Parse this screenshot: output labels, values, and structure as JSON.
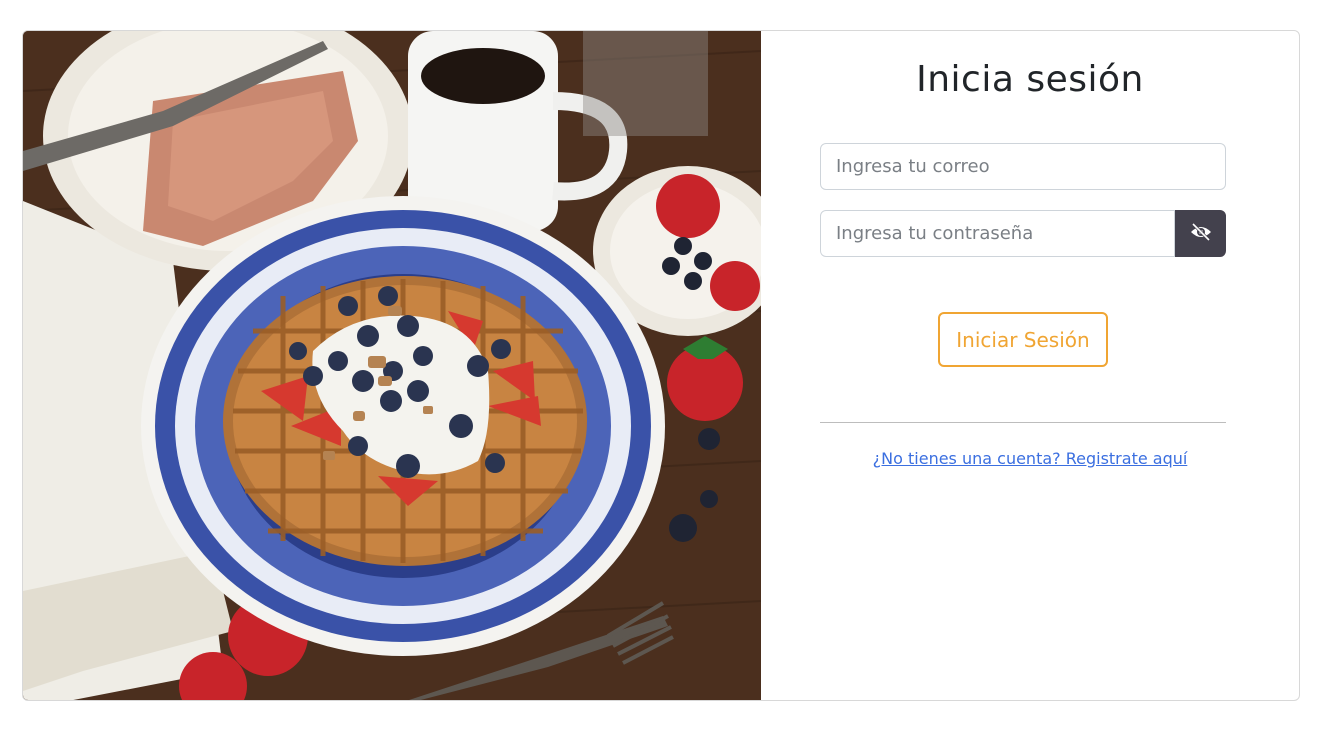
{
  "login": {
    "title": "Inicia sesión",
    "email_placeholder": "Ingresa tu correo",
    "password_placeholder": "Ingresa tu contraseña",
    "toggle_icon": "eye-slash-icon",
    "submit_label": "Iniciar Sesión",
    "register_link": "¿No tienes una cuenta? Registrate aquí"
  },
  "colors": {
    "accent": "#f0a533",
    "toggle_button": "#43414d",
    "link": "#3b6fe0"
  },
  "image": {
    "description_name": "waffle-breakfast-photo"
  }
}
